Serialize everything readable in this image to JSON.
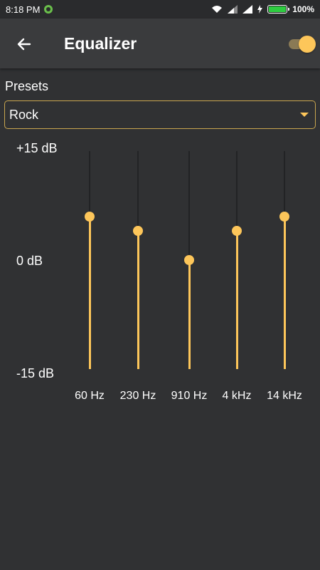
{
  "status_bar": {
    "time": "8:18 PM",
    "battery_percent": "100%",
    "app_icon": "notification-app-icon",
    "icons": [
      "wifi-icon",
      "signal-icon",
      "signal-icon",
      "charge-icon",
      "battery-icon"
    ]
  },
  "app_bar": {
    "title": "Equalizer",
    "back_icon": "arrow-left-icon",
    "enabled": true
  },
  "presets": {
    "label": "Presets",
    "selected": "Rock"
  },
  "db_scale": {
    "max": "+15 dB",
    "mid": "0 dB",
    "min": "-15 dB"
  },
  "bands": [
    {
      "label": "60 Hz",
      "gain_db": 6
    },
    {
      "label": "230 Hz",
      "gain_db": 4
    },
    {
      "label": "910 Hz",
      "gain_db": 0
    },
    {
      "label": "4 kHz",
      "gain_db": 4
    },
    {
      "label": "14 kHz",
      "gain_db": 6
    }
  ],
  "colors": {
    "accent": "#fdc65a",
    "background": "#303133",
    "app_bar": "#3a3b3d"
  }
}
